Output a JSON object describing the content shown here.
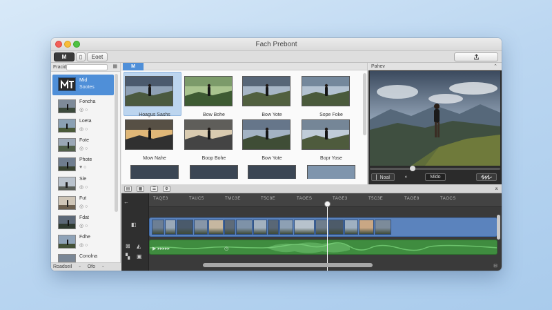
{
  "window": {
    "title": "Fach Prebont"
  },
  "toolbar": {
    "media_label": "M",
    "mid_label": "▯",
    "import_label": "Eoet",
    "share_icon": "share-icon"
  },
  "sidebar": {
    "header": "Fracid",
    "selected": {
      "label": "Mid",
      "sub": "Sootes"
    },
    "items": [
      {
        "label": "Foncha",
        "sub": "◎ ○"
      },
      {
        "label": "Loeta",
        "sub": "◎ ○"
      },
      {
        "label": "Fote",
        "sub": "◎ ○"
      },
      {
        "label": "Phote",
        "sub": "♥ ○"
      },
      {
        "label": "Sle",
        "sub": "◎ ○"
      },
      {
        "label": "Fut",
        "sub": "◎ ○"
      },
      {
        "label": "Fdat",
        "sub": "◎ ○"
      },
      {
        "label": "Fdhe",
        "sub": "◎ ○"
      },
      {
        "label": "Conolna",
        "sub": ""
      }
    ],
    "footer": [
      "Roadseil",
      "◦",
      "Ofo",
      "◦"
    ]
  },
  "browser": {
    "tab": "M",
    "clips": [
      {
        "label": "Hoagus Sashs"
      },
      {
        "label": "Bow Bohe"
      },
      {
        "label": "Bow Yote"
      },
      {
        "label": "Sope Foke"
      },
      {
        "label": "Mow Nahe"
      },
      {
        "label": "Boop Bohe"
      },
      {
        "label": "Bow Yote"
      },
      {
        "label": "Bopr Yose"
      }
    ]
  },
  "viewer": {
    "header": "Pahev",
    "controls": {
      "left": "▏Noal",
      "center": "◐",
      "right": "Mido"
    },
    "playhead_fraction": 0.33
  },
  "timeline": {
    "ruler": [
      "TAQE3",
      "TAUC5",
      "TMC3E",
      "T5C8E",
      "TAOES",
      "TAGE3",
      "T5C3E",
      "TAOE8",
      "TAOCS"
    ],
    "playhead_fraction": 0.51
  }
}
